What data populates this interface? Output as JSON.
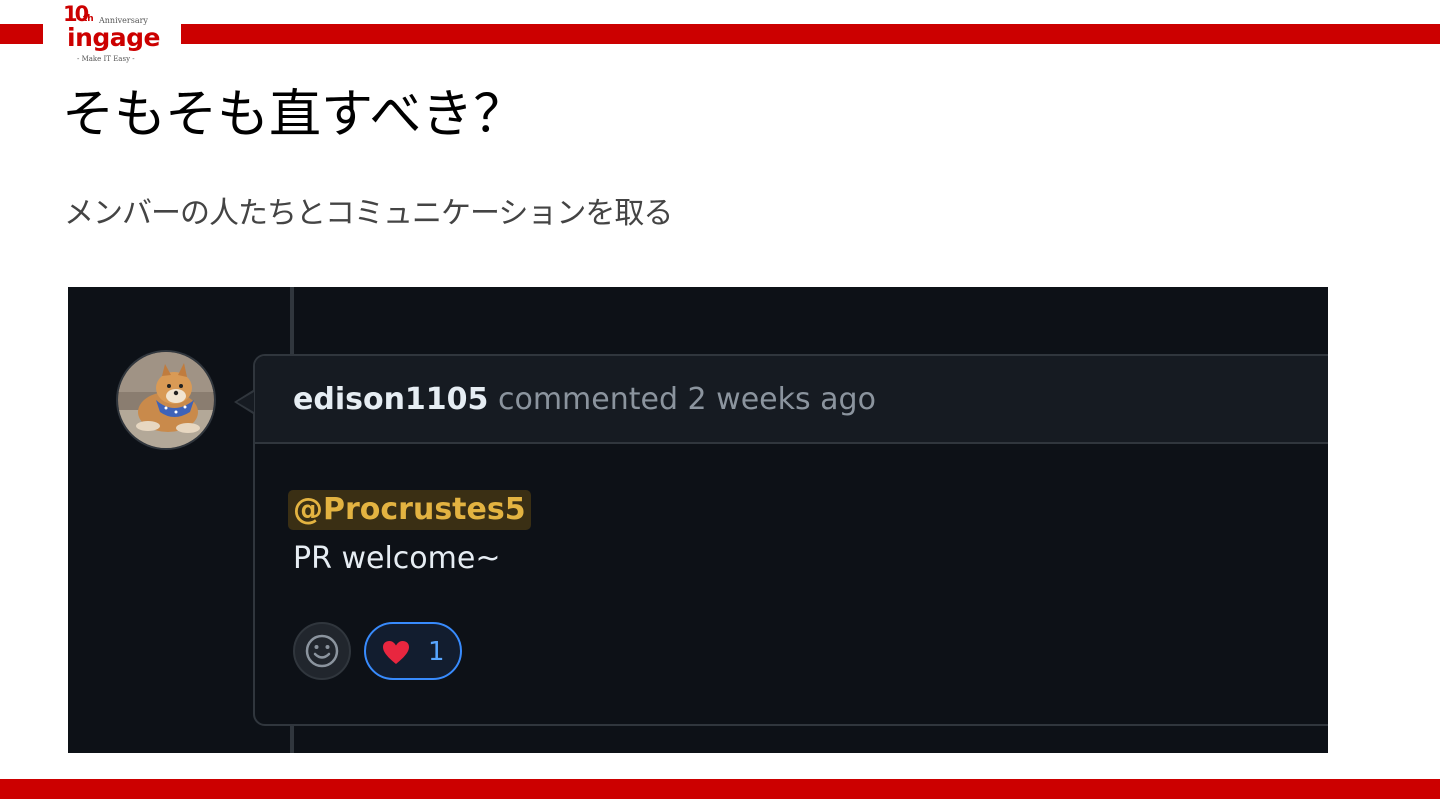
{
  "slide": {
    "title": "そもそも直すべき？",
    "subtitle": "メンバーの人たちとコミュニケーションを取る"
  },
  "logo": {
    "anniversary_number": "10",
    "anniversary_suffix": "th",
    "anniversary_label": "Anniversary",
    "brand": "ingage",
    "tagline": "- Make IT Easy -"
  },
  "comment": {
    "author": "edison1105",
    "meta": "commented 2 weeks ago",
    "mention": "@Procrustes5",
    "body": "PR welcome~",
    "reactions": [
      {
        "icon": "heart-icon",
        "count": "1"
      }
    ]
  },
  "colors": {
    "brand_red": "#cc0000",
    "github_bg": "#0d1117",
    "mention_yellow": "#e3b341",
    "reaction_blue": "#388bfd"
  }
}
